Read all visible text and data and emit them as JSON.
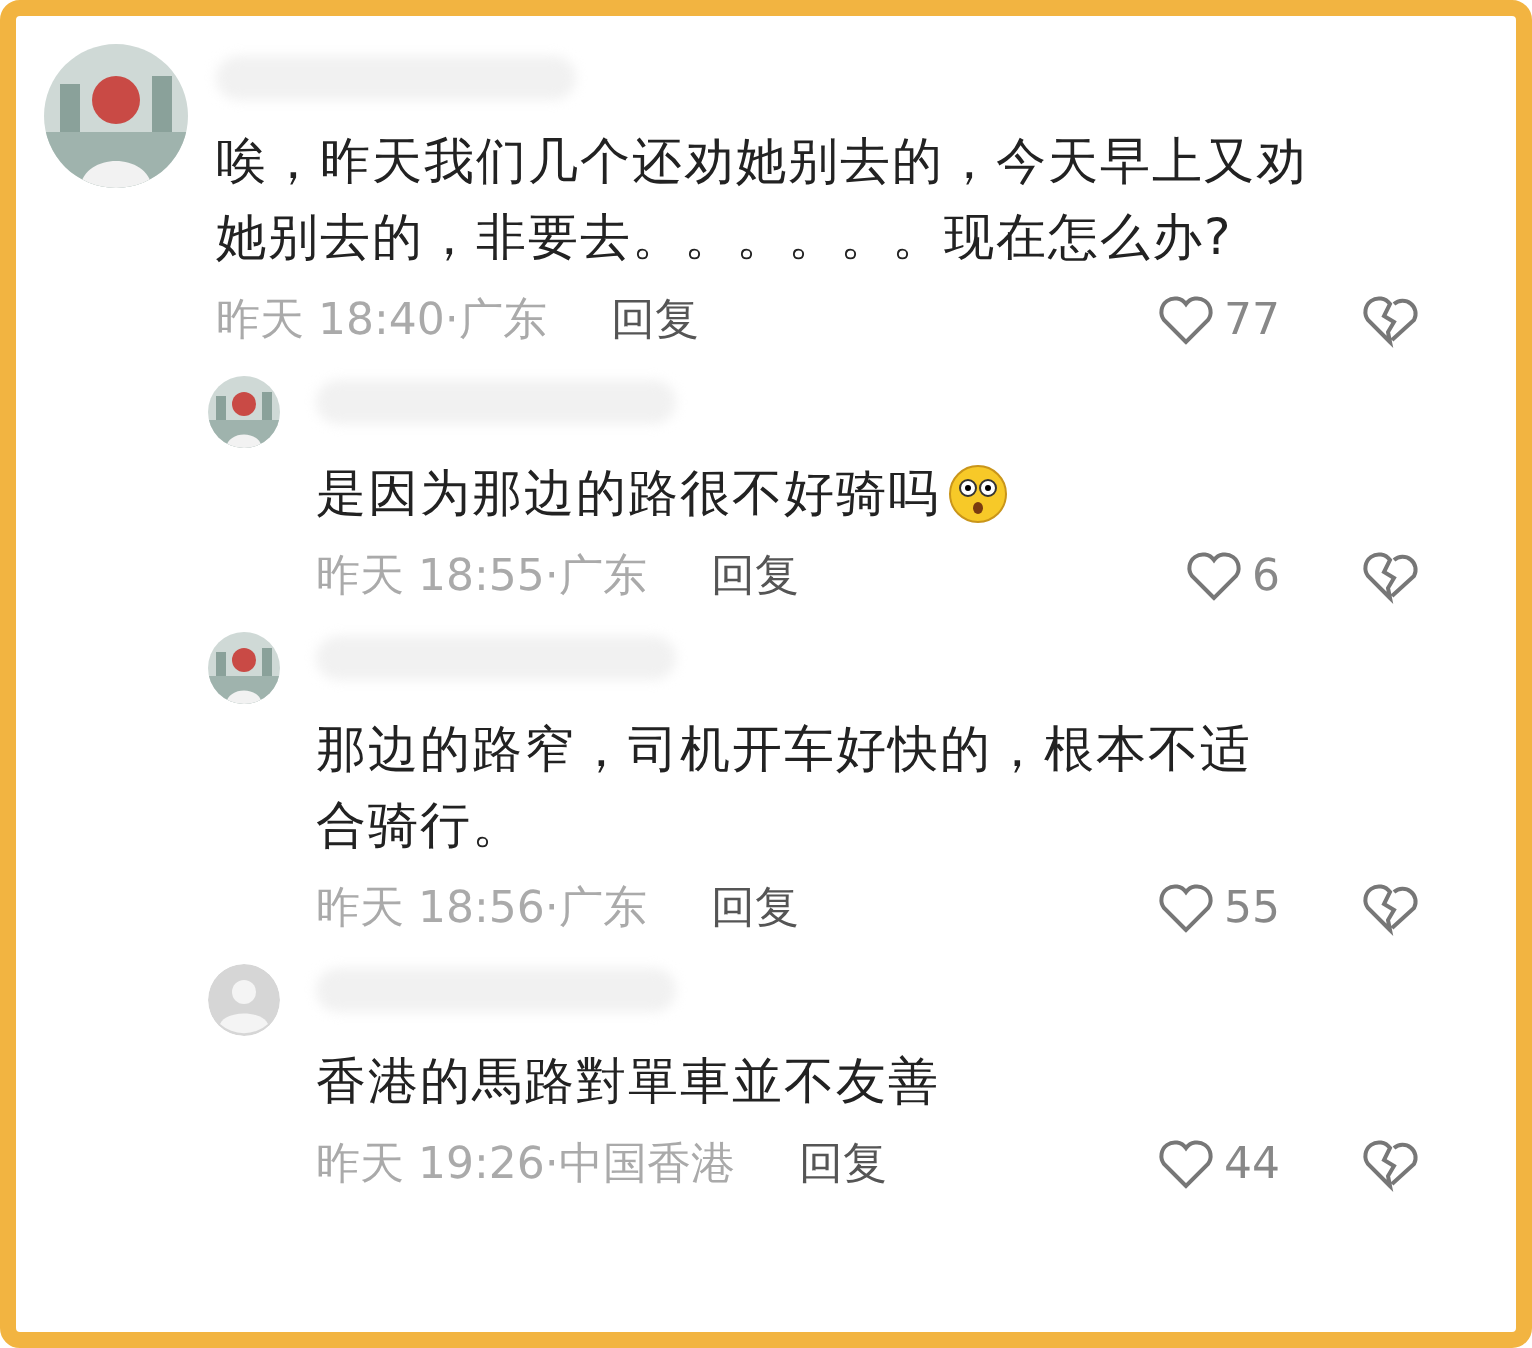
{
  "comments": [
    {
      "default_avatar": false,
      "text": "唉，昨天我们几个还劝她别去的，今天早上又劝她别去的，非要去。。。。。。现在怎么办?",
      "meta": "昨天 18:40·广东",
      "reply": "回复",
      "likes": "77",
      "children": [
        {
          "default_avatar": false,
          "text": "是因为那边的路很不好骑吗",
          "emoji": true,
          "meta": "昨天 18:55·广东",
          "reply": "回复",
          "likes": "6"
        },
        {
          "default_avatar": false,
          "text": "那边的路窄，司机开车好快的，根本不适合骑行。",
          "emoji": false,
          "meta": "昨天 18:56·广东",
          "reply": "回复",
          "likes": "55"
        },
        {
          "default_avatar": true,
          "text": "香港的馬路對單車並不友善",
          "emoji": false,
          "meta": "昨天 19:26·中国香港",
          "reply": "回复",
          "likes": "44"
        }
      ]
    }
  ]
}
